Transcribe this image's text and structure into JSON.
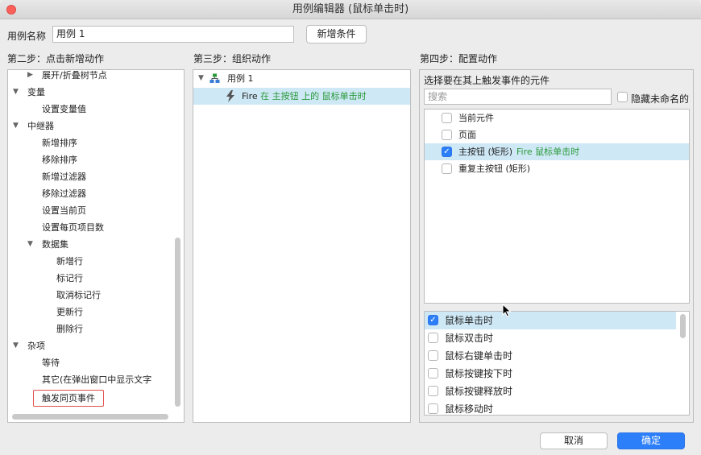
{
  "window": {
    "title": "用例编辑器 (鼠标单击时)"
  },
  "case_name": {
    "label": "用例名称",
    "value": "用例 1",
    "add_condition": "新增条件"
  },
  "step2": {
    "title": "第二步：点击新增动作",
    "items": [
      {
        "label": "展开/折叠树节点",
        "level": 2,
        "caret": "right"
      },
      {
        "label": "变量",
        "level": 1,
        "caret": "down"
      },
      {
        "label": "设置变量值",
        "level": 2
      },
      {
        "label": "中继器",
        "level": 1,
        "caret": "down"
      },
      {
        "label": "新增排序",
        "level": 2
      },
      {
        "label": "移除排序",
        "level": 2
      },
      {
        "label": "新增过滤器",
        "level": 2
      },
      {
        "label": "移除过滤器",
        "level": 2
      },
      {
        "label": "设置当前页",
        "level": 2
      },
      {
        "label": "设置每页项目数",
        "level": 2
      },
      {
        "label": "数据集",
        "level": 2,
        "caret": "down"
      },
      {
        "label": "新增行",
        "level": 3
      },
      {
        "label": "标记行",
        "level": 3
      },
      {
        "label": "取消标记行",
        "level": 3
      },
      {
        "label": "更新行",
        "level": 3
      },
      {
        "label": "删除行",
        "level": 3
      },
      {
        "label": "杂项",
        "level": 1,
        "caret": "down"
      },
      {
        "label": "等待",
        "level": 2
      },
      {
        "label": "其它(在弹出窗口中显示文字",
        "level": 2
      },
      {
        "label": "触发同页事件",
        "level": 2,
        "boxed": true
      }
    ]
  },
  "step3": {
    "title": "第三步：组织动作",
    "case_label": "用例 1",
    "action": {
      "fire": "Fire",
      "in": "在",
      "target": "主按钮",
      "on": "上的",
      "event": "鼠标单击时"
    }
  },
  "step4": {
    "title": "第四步：配置动作",
    "subtitle": "选择要在其上触发事件的元件",
    "search_placeholder": "搜索",
    "hide_unnamed": "隐藏未命名的",
    "widgets": [
      {
        "label": "当前元件",
        "checked": false,
        "extra": ""
      },
      {
        "label": "页面",
        "checked": false,
        "extra": ""
      },
      {
        "label": "主按钮 (矩形)",
        "checked": true,
        "extra": "Fire 鼠标单击时"
      },
      {
        "label": "重复主按钮 (矩形)",
        "checked": false,
        "extra": ""
      }
    ],
    "events": [
      {
        "label": "鼠标单击时",
        "checked": true
      },
      {
        "label": "鼠标双击时",
        "checked": false
      },
      {
        "label": "鼠标右键单击时",
        "checked": false
      },
      {
        "label": "鼠标按键按下时",
        "checked": false
      },
      {
        "label": "鼠标按键释放时",
        "checked": false
      },
      {
        "label": "鼠标移动时",
        "checked": false
      }
    ]
  },
  "footer": {
    "cancel": "取消",
    "ok": "确定"
  },
  "colors": {
    "ok_button": "#2d7ff9",
    "highlight": "#cfe8f6",
    "green_text": "#2a9a3a",
    "boxed_outline": "#e0524f"
  }
}
